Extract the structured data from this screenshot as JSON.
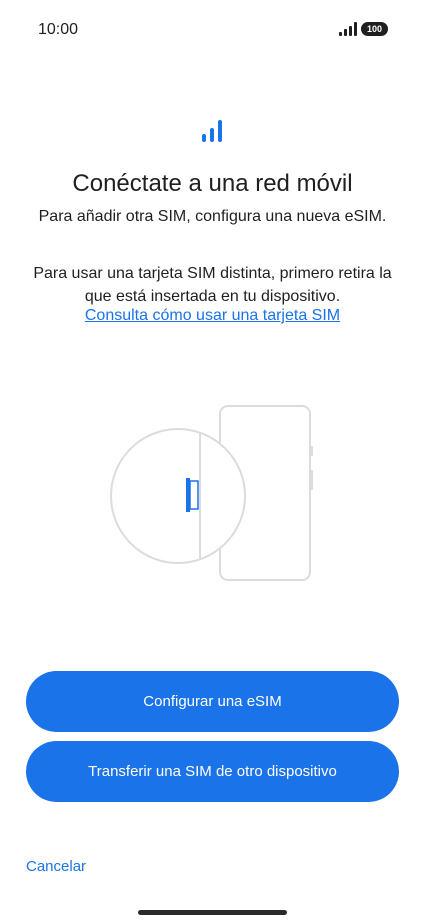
{
  "status_bar": {
    "time": "10:00",
    "battery_level": "100",
    "signal_icon": "signal-bars-icon",
    "battery_icon": "battery-icon"
  },
  "header": {
    "icon": "cellular-signal-icon",
    "title": "Conéctate a una red móvil",
    "subtitle": "Para añadir otra SIM, configura una nueva eSIM."
  },
  "body": {
    "text": "Para usar una tarjeta SIM distinta, primero retira la que está insertada en tu dispositivo.",
    "link": "Consulta cómo usar una tarjeta SIM"
  },
  "illustration": {
    "icon": "sim-tray-illustration-icon"
  },
  "actions": {
    "configure_esim": "Configurar una eSIM",
    "transfer_sim": "Transferir una SIM de otro dispositivo",
    "cancel": "Cancelar"
  },
  "colors": {
    "accent": "#1a73e8",
    "illustration_stroke": "#dadce0",
    "text": "#1f1f1f"
  }
}
